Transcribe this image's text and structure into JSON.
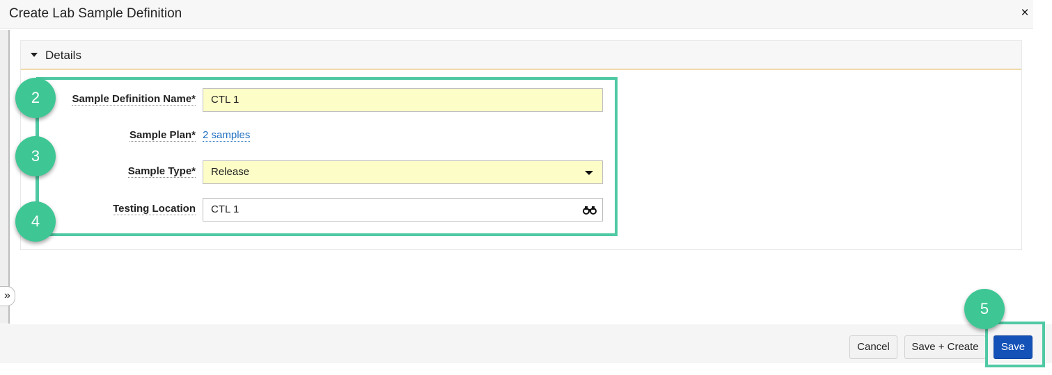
{
  "dialog": {
    "title": "Create Lab Sample Definition",
    "close_label": "×",
    "expand_label": "»"
  },
  "details": {
    "section_title": "Details",
    "fields": {
      "name": {
        "label": "Sample Definition Name*",
        "value": "CTL 1"
      },
      "plan": {
        "label": "Sample Plan*",
        "link": "2 samples"
      },
      "type": {
        "label": "Sample Type*",
        "value": "Release"
      },
      "location": {
        "label": "Testing Location",
        "value": "CTL 1"
      }
    }
  },
  "steps": [
    "2",
    "3",
    "4",
    "5"
  ],
  "footer": {
    "cancel": "Cancel",
    "save_create": "Save + Create",
    "save": "Save"
  },
  "colors": {
    "highlight": "#4fc9a3",
    "step_circle": "#3ec795",
    "required_field": "#fdfdc7",
    "primary_button": "#1452b8",
    "link": "#1f6fbf",
    "section_rule": "#d9a62e"
  },
  "icons": {
    "close": "close-icon",
    "expand": "double-chevron-right-icon",
    "caret": "caret-down-icon",
    "dropdown": "dropdown-arrow-icon",
    "lookup": "binoculars-icon"
  }
}
